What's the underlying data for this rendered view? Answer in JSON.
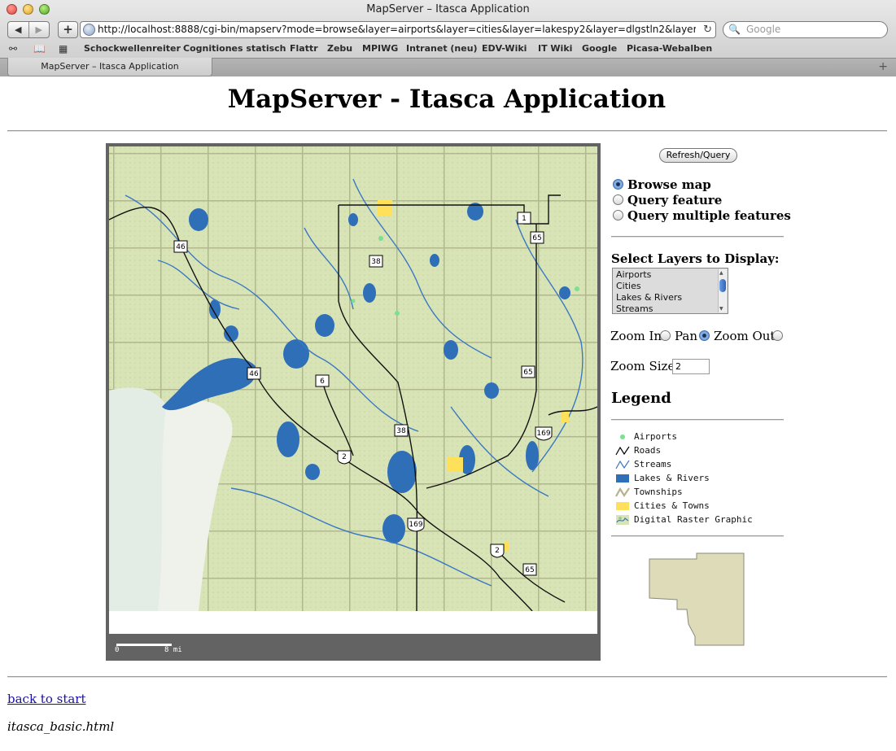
{
  "browser": {
    "window_title": "MapServer – Itasca Application",
    "url": "http://localhost:8888/cgi-bin/mapserv?mode=browse&layer=airports&layer=cities&layer=lakespy2&layer=dlgstln2&layer=ro",
    "search_placeholder": "Google",
    "bookmarks": [
      "Schockwellenreiter",
      "Cognitiones statisch",
      "Flattr",
      "Zebu",
      "MPIWG",
      "Intranet (neu)",
      "EDV-Wiki",
      "IT Wiki",
      "Google",
      "Picasa-Webalben"
    ],
    "tab_title": "MapServer – Itasca Application",
    "icons": {
      "back": "◀",
      "forward": "▶",
      "add": "+",
      "reload": "↻",
      "search": "🔍",
      "reading_list": "⚯",
      "bookmarks_book": "📖",
      "top_sites": "▦",
      "new_tab": "+"
    }
  },
  "page": {
    "title": "MapServer - Itasca Application",
    "refresh_button": "Refresh/Query",
    "modes": [
      {
        "label": "Browse map",
        "checked": true
      },
      {
        "label": "Query feature",
        "checked": false
      },
      {
        "label": "Query multiple features",
        "checked": false
      }
    ],
    "layers_heading": "Select Layers to Display:",
    "layers": [
      "Airports",
      "Cities",
      "Lakes & Rivers",
      "Streams"
    ],
    "zoom": {
      "zoom_in_label": "Zoom In",
      "pan_label": "Pan",
      "zoom_out_label": "Zoom Out",
      "selected": "pan"
    },
    "zoom_size_label": "Zoom Size",
    "zoom_size_value": "2",
    "legend_heading": "Legend",
    "legend": [
      {
        "label": "Airports",
        "symbol": "dot",
        "color": "#7be08f"
      },
      {
        "label": "Roads",
        "symbol": "line",
        "color": "#000000"
      },
      {
        "label": "Streams",
        "symbol": "line",
        "color": "#3a78c2"
      },
      {
        "label": "Lakes & Rivers",
        "symbol": "fill",
        "color": "#2f6fb8"
      },
      {
        "label": "Townships",
        "symbol": "line",
        "color": "#b6b18f"
      },
      {
        "label": "Cities & Towns",
        "symbol": "fill",
        "color": "#ffe05a"
      },
      {
        "label": "Digital Raster Graphic",
        "symbol": "image",
        "color": "#9cc8a0"
      }
    ],
    "scale_bar": {
      "start": "0",
      "end": "8 mi"
    },
    "highway_shields": [
      "1",
      "65",
      "46",
      "38",
      "46",
      "6",
      "65",
      "38",
      "2",
      "169",
      "169",
      "2",
      "65"
    ],
    "back_link": "back to start",
    "footer_file": "itasca_basic.html"
  },
  "colors": {
    "map_background": "#d8e4b6",
    "water": "#2f6fb8",
    "city": "#ffe05a",
    "reference_map_fill": "#dedcb8",
    "frame": "#636363",
    "link": "#1a0dab"
  }
}
